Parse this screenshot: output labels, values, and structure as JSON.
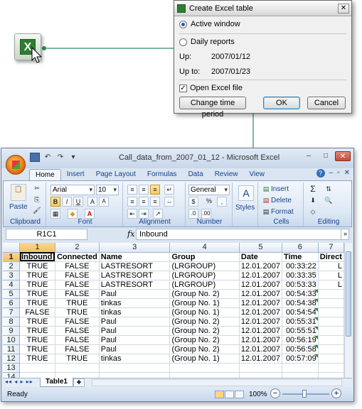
{
  "dialog": {
    "title": "Create Excel table",
    "close_icon": "close-icon",
    "options": [
      {
        "label": "Active window",
        "selected": true
      },
      {
        "label": "Daily reports",
        "selected": false
      }
    ],
    "up_label": "Up:",
    "up_value": "2007/01/12",
    "upto_label": "Up to:",
    "upto_value": "2007/01/23",
    "open_excel_label": "Open Excel file",
    "open_excel_checked": true,
    "change_button": "Change time period",
    "ok_button": "OK",
    "cancel_button": "Cancel"
  },
  "excel": {
    "title": "Call_data_from_2007_01_12 - Microsoft Excel",
    "tabs": [
      "Home",
      "Insert",
      "Page Layout",
      "Formulas",
      "Data",
      "Review",
      "View"
    ],
    "active_tab": "Home",
    "ribbon": {
      "clipboard": {
        "label": "Clipboard",
        "paste": "Paste"
      },
      "font": {
        "label": "Font",
        "name": "Arial",
        "size": "10"
      },
      "alignment": {
        "label": "Alignment"
      },
      "number": {
        "label": "Number",
        "format": "General",
        "percent": "%"
      },
      "styles": {
        "label": "Styles"
      },
      "cells": {
        "label": "Cells",
        "insert": "Insert",
        "delete": "Delete",
        "format": "Format"
      },
      "editing": {
        "label": "Editing"
      }
    },
    "namebox": "R1C1",
    "fx": "fx",
    "formula": "Inbound",
    "columns": [
      "1",
      "2",
      "3",
      "4",
      "5",
      "6",
      "7"
    ],
    "rows": [
      [
        "Inbound",
        "Connected",
        "Name",
        "Group",
        "Date",
        "Time",
        "Direct"
      ],
      [
        "TRUE",
        "FALSE",
        "LASTRESORT",
        "(LRGROUP)",
        "12.01.2007",
        "00:33:22",
        "L"
      ],
      [
        "TRUE",
        "FALSE",
        "LASTRESORT",
        "(LRGROUP)",
        "12.01.2007",
        "00:33:35",
        "L"
      ],
      [
        "TRUE",
        "FALSE",
        "LASTRESORT",
        "(LRGROUP)",
        "12.01.2007",
        "00:53:33",
        "L"
      ],
      [
        "TRUE",
        "FALSE",
        "Paul",
        "(Group No.  2)",
        "12.01.2007",
        "00:54:33",
        ""
      ],
      [
        "TRUE",
        "TRUE",
        "tinkas",
        "(Group No.  1)",
        "12.01.2007",
        "00:54:38",
        ""
      ],
      [
        "FALSE",
        "TRUE",
        "tinkas",
        "(Group No.  1)",
        "12.01.2007",
        "00:54:54",
        ""
      ],
      [
        "TRUE",
        "FALSE",
        "Paul",
        "(Group No.  2)",
        "12.01.2007",
        "00:55:31",
        ""
      ],
      [
        "TRUE",
        "FALSE",
        "Paul",
        "(Group No.  2)",
        "12.01.2007",
        "00:55:51",
        ""
      ],
      [
        "TRUE",
        "FALSE",
        "Paul",
        "(Group No.  2)",
        "12.01.2007",
        "00:56:19",
        ""
      ],
      [
        "TRUE",
        "FALSE",
        "Paul",
        "(Group No.  2)",
        "12.01.2007",
        "00:56:58",
        ""
      ],
      [
        "TRUE",
        "TRUE",
        "tinkas",
        "(Group No.  1)",
        "12.01.2007",
        "00:57:09",
        ""
      ],
      [
        "",
        "",
        "",
        "",
        "",
        "",
        ""
      ],
      [
        "",
        "",
        "",
        "",
        "",
        "",
        ""
      ]
    ],
    "sheet_tab": "Table1",
    "status": "Ready",
    "zoom": "100%",
    "zoom_minus": "−",
    "zoom_plus": "+"
  },
  "colors": {
    "connector": "#2e8b57",
    "accent": "#15428b"
  }
}
